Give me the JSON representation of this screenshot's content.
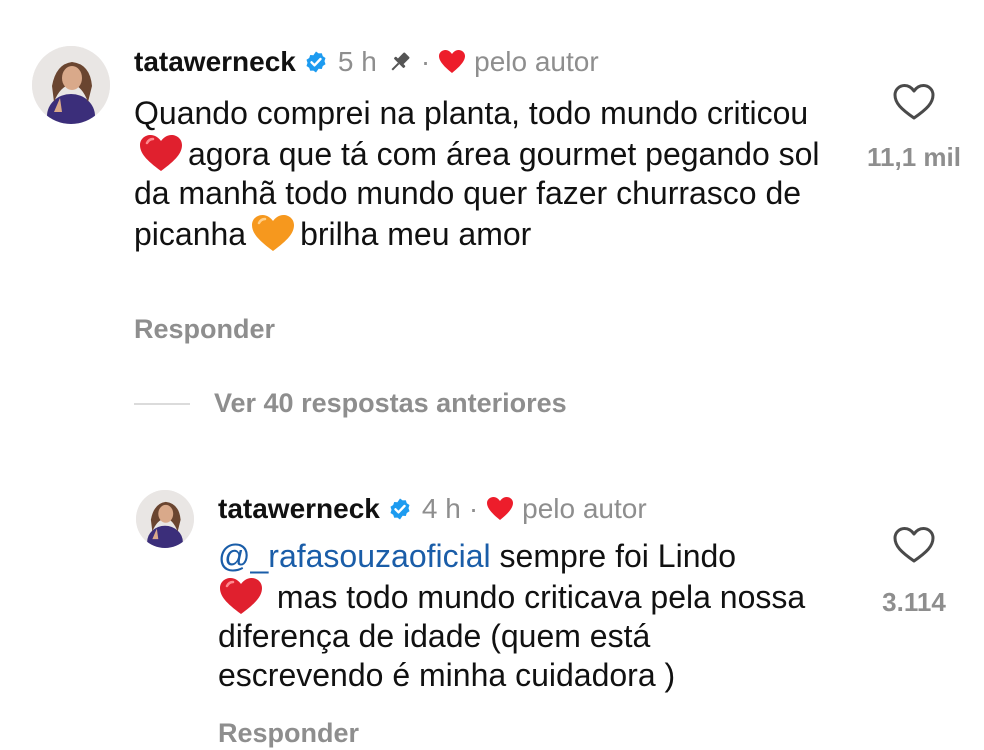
{
  "comments": [
    {
      "username": "tatawerneck",
      "time": "5 h",
      "separator": "·",
      "author_label": "pelo autor",
      "text_parts": [
        "Quando comprei na planta, todo mundo criticou",
        "agora que tá com área gourmet pegando sol da manhã todo mundo quer fazer churrasco de picanha",
        "brilha meu amor"
      ],
      "emojis": [
        "red-heart-emoji",
        "orange-heart-emoji"
      ],
      "reply_label": "Responder",
      "like_count": "11,1 mil",
      "pinned": true
    },
    {
      "username": "tatawerneck",
      "time": "4 h",
      "separator": "·",
      "author_label": "pelo autor",
      "mention": "@_rafasouzaoficial",
      "text_parts": [
        "sempre foi Lindo",
        "mas todo mundo criticava pela nossa diferença de idade (quem está escrevendo é minha cuidadora )"
      ],
      "emojis": [
        "red-heart-emoji"
      ],
      "reply_label": "Responder",
      "like_count": "3.114",
      "pinned": false
    }
  ],
  "view_replies_label": "Ver 40 respostas anteriores",
  "colors": {
    "muted": "#8e8e8e",
    "heart_red": "#ed1d2b",
    "verified_blue": "#1d9bf0",
    "mention_blue": "#1a5da8",
    "orange_heart": "#f6981e"
  }
}
